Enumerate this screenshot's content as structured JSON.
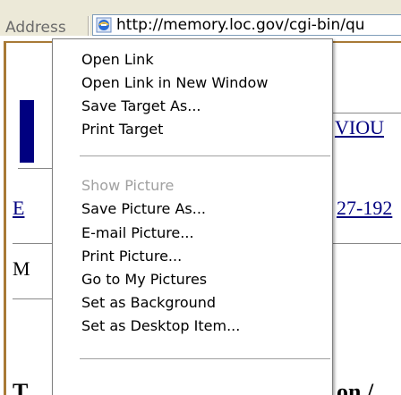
{
  "address_bar": {
    "label": "Address",
    "url": "http://memory.loc.gov/cgi-bin/qu",
    "icon": "ie-page-icon"
  },
  "page": {
    "link_fragment_1": "E",
    "link_fragment_2": "VIOU",
    "link_fragment_3": "27-192",
    "text_fragment_m": "M",
    "text_fragment_t": "T",
    "text_fragment_on": "on /"
  },
  "context_menu": {
    "items": [
      {
        "label": "Open Link",
        "enabled": true
      },
      {
        "label": "Open Link in New Window",
        "enabled": true
      },
      {
        "label": "Save Target As...",
        "enabled": true
      },
      {
        "label": "Print Target",
        "enabled": true
      },
      {
        "label": "Show Picture",
        "enabled": false
      },
      {
        "label": "Save Picture As...",
        "enabled": true
      },
      {
        "label": "E-mail Picture...",
        "enabled": true
      },
      {
        "label": "Print Picture...",
        "enabled": true
      },
      {
        "label": "Go to My Pictures",
        "enabled": true
      },
      {
        "label": "Set as Background",
        "enabled": true
      },
      {
        "label": "Set as Desktop Item...",
        "enabled": true
      }
    ]
  }
}
